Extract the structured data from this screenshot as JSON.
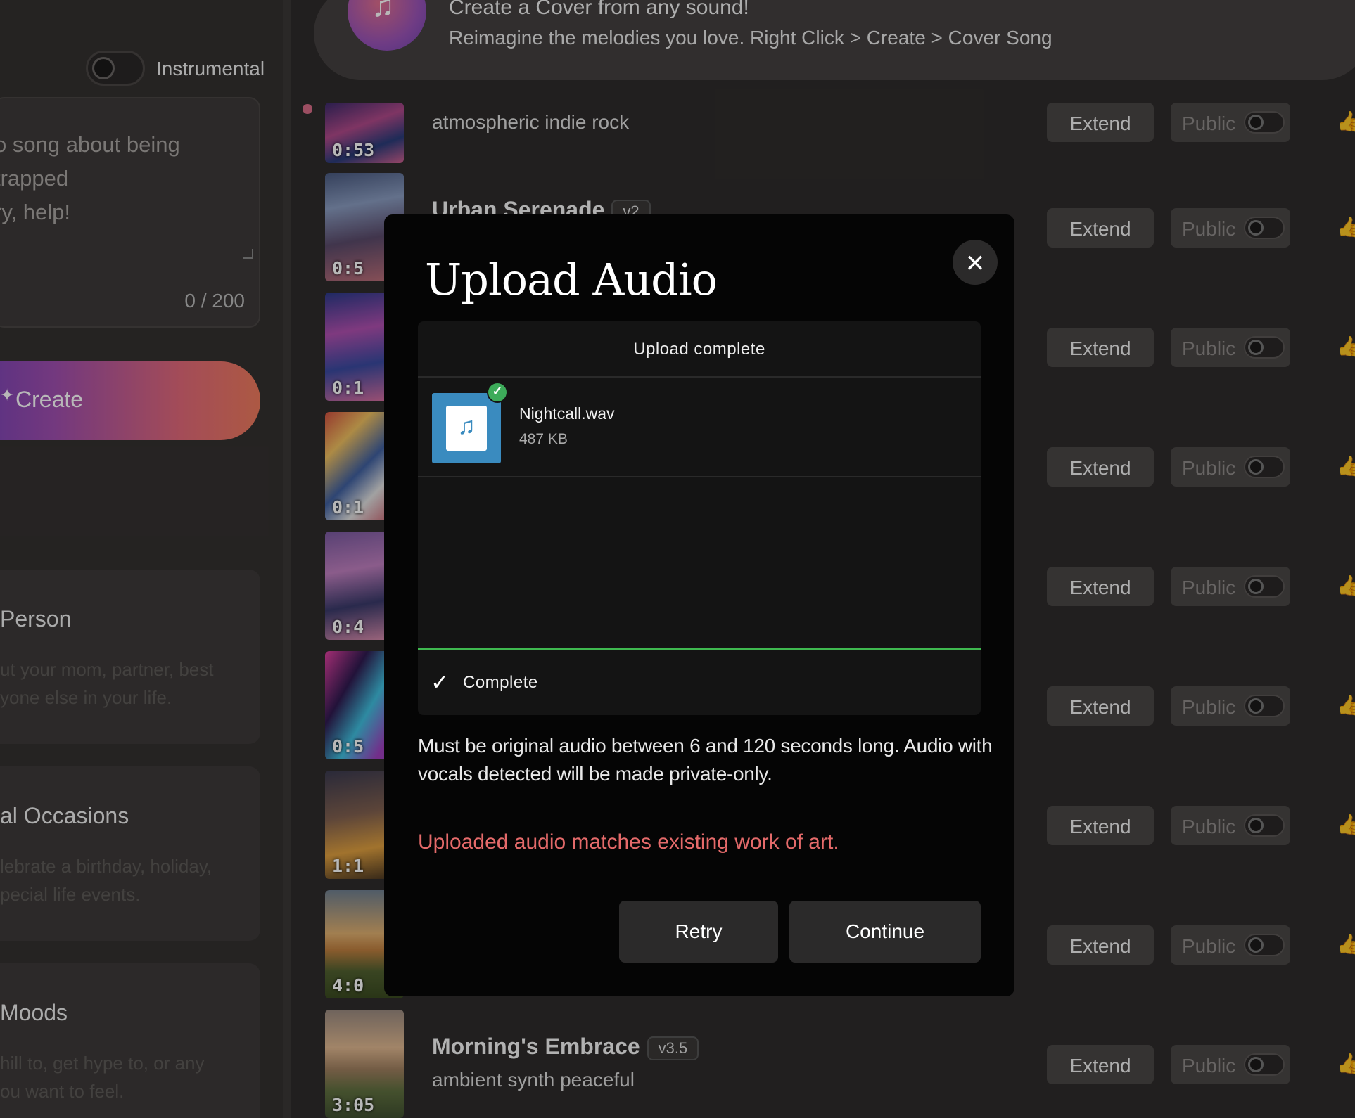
{
  "sidebar": {
    "instrumental_label": "Instrumental",
    "prompt_text": "o song about being trapped\nry, help!",
    "char_count": "0 / 200",
    "create_label": "Create",
    "cards": [
      {
        "title": "Person",
        "desc": "ut your mom, partner, best\nyone else in your life."
      },
      {
        "title": "al Occasions",
        "desc": "lebrate a birthday, holiday,\npecial life events."
      },
      {
        "title": "Moods",
        "desc": "hill to, get hype to, or any\nou want to feel."
      }
    ]
  },
  "banner": {
    "title": "Create a Cover from any sound!",
    "subtitle": "Reimagine the melodies you love. Right Click > Create > Cover Song",
    "icon": "music-note-icon"
  },
  "songs": [
    {
      "title": "",
      "version": "",
      "desc": "atmospheric indie rock",
      "duration": "0:53"
    },
    {
      "title": "Urban Serenade",
      "version": "v2",
      "desc": "",
      "duration": "0:5"
    },
    {
      "title": "",
      "version": "",
      "desc": "",
      "duration": "0:1"
    },
    {
      "title": "",
      "version": "",
      "desc": "",
      "duration": "0:1"
    },
    {
      "title": "",
      "version": "",
      "desc": "",
      "duration": "0:4"
    },
    {
      "title": "",
      "version": "",
      "desc": "",
      "duration": "0:5"
    },
    {
      "title": "",
      "version": "",
      "desc": "",
      "duration": "1:1"
    },
    {
      "title": "",
      "version": "",
      "desc": "",
      "duration": "4:0"
    },
    {
      "title": "Morning's Embrace",
      "version": "v3.5",
      "desc": "ambient synth peaceful",
      "duration": "3:05"
    }
  ],
  "row_actions": {
    "extend_label": "Extend",
    "public_label": "Public"
  },
  "modal": {
    "title": "Upload Audio",
    "close_icon": "close-icon",
    "status": "Upload complete",
    "file_name": "Nightcall.wav",
    "file_size": "487 KB",
    "progress": 1.0,
    "complete_label": "Complete",
    "note": "Must be original audio between 6 and 120 seconds long. Audio with vocals detected will be made private-only.",
    "error": "Uploaded audio matches existing work of art.",
    "retry_label": "Retry",
    "continue_label": "Continue"
  },
  "colors": {
    "progress": "#3fb950",
    "error": "#e46a6a",
    "file_icon": "#3a8bbf"
  }
}
